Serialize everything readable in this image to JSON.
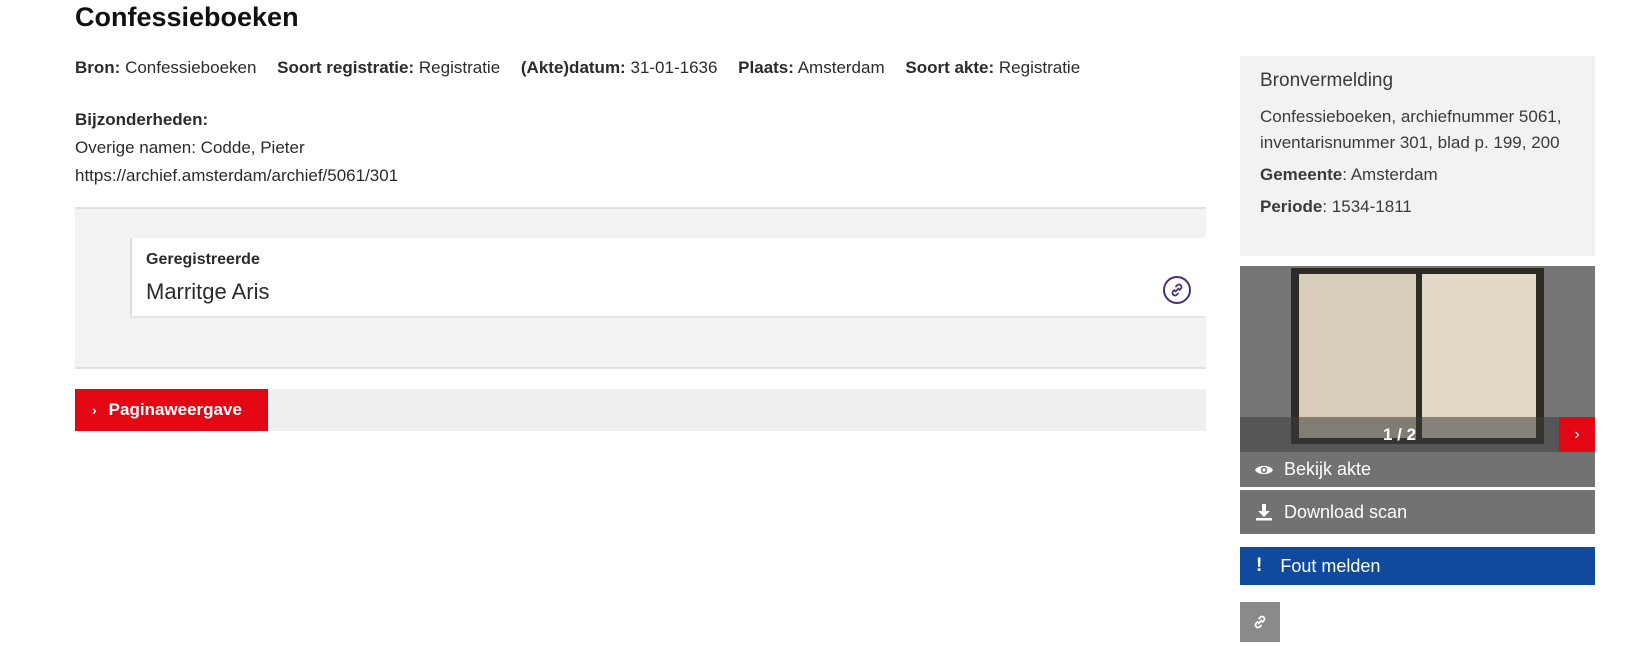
{
  "page": {
    "title": "Confessieboeken"
  },
  "meta": [
    {
      "label": "Bron:",
      "value": "Confessieboeken"
    },
    {
      "label": "Soort registratie:",
      "value": "Registratie"
    },
    {
      "label": "(Akte)datum:",
      "value": "31-01-1636"
    },
    {
      "label": "Plaats:",
      "value": "Amsterdam"
    },
    {
      "label": "Soort akte:",
      "value": "Registratie"
    }
  ],
  "details": {
    "label": "Bijzonderheden:",
    "other_names": "Overige namen: Codde, Pieter",
    "url": "https://archief.amsterdam/archief/5061/301"
  },
  "registration": {
    "label": "Geregistreerde",
    "name": "Marritge Aris",
    "link_icon": "link-icon"
  },
  "paging": {
    "label": "Paginaweergave",
    "icon": "chevron-right-icon"
  },
  "source_citation": {
    "title": "Bronvermelding",
    "text": "Confessieboeken, archiefnummer 5061, inventarisnummer 301, blad p. 199, 200",
    "municipality_label": "Gemeente",
    "municipality_value": ": Amsterdam",
    "period_label": "Periode",
    "period_value": ": 1534-1811"
  },
  "scan": {
    "counter": "1 / 2",
    "next_icon": "chevron-right-icon"
  },
  "actions": {
    "view_label": "Bekijk akte",
    "view_icon": "eye-icon",
    "download_label": "Download scan",
    "download_icon": "download-icon",
    "report_label": "Fout melden",
    "report_icon": "exclamation-icon",
    "share_icon": "link-icon"
  },
  "colors": {
    "accent_red": "#e30613",
    "report_blue": "#0f4a9c",
    "action_gray": "#727272",
    "link_purple": "#4a2f7a"
  }
}
